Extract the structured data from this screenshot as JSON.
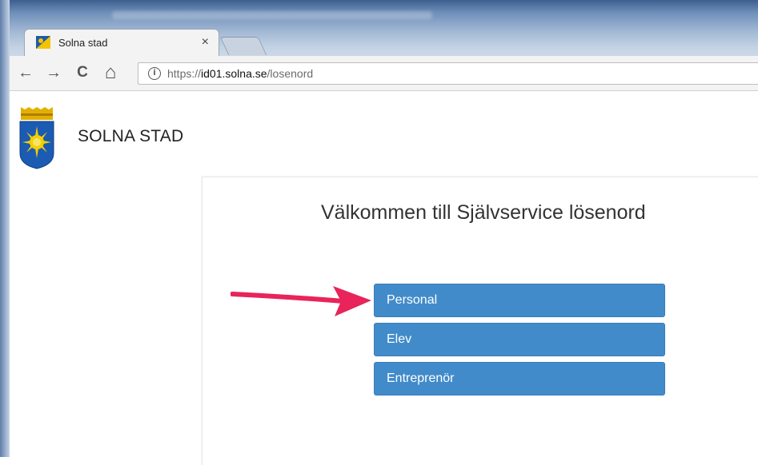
{
  "browser": {
    "tab": {
      "title": "Solna stad",
      "close": "×"
    },
    "toolbar": {
      "back": "←",
      "forward": "→",
      "reload": "C",
      "home": "⌂",
      "url_scheme": "https://",
      "url_host": "id01.solna.se",
      "url_path": "/losenord"
    }
  },
  "header": {
    "site_name": "SOLNA STAD",
    "logo_icon": "solna-coat-of-arms"
  },
  "main": {
    "title": "Välkommen till Självservice lösenord",
    "buttons": [
      "Personal",
      "Elev",
      "Entreprenör"
    ],
    "button_color": "#428bca",
    "annotation": "red-arrow-pointing-at-personal"
  }
}
